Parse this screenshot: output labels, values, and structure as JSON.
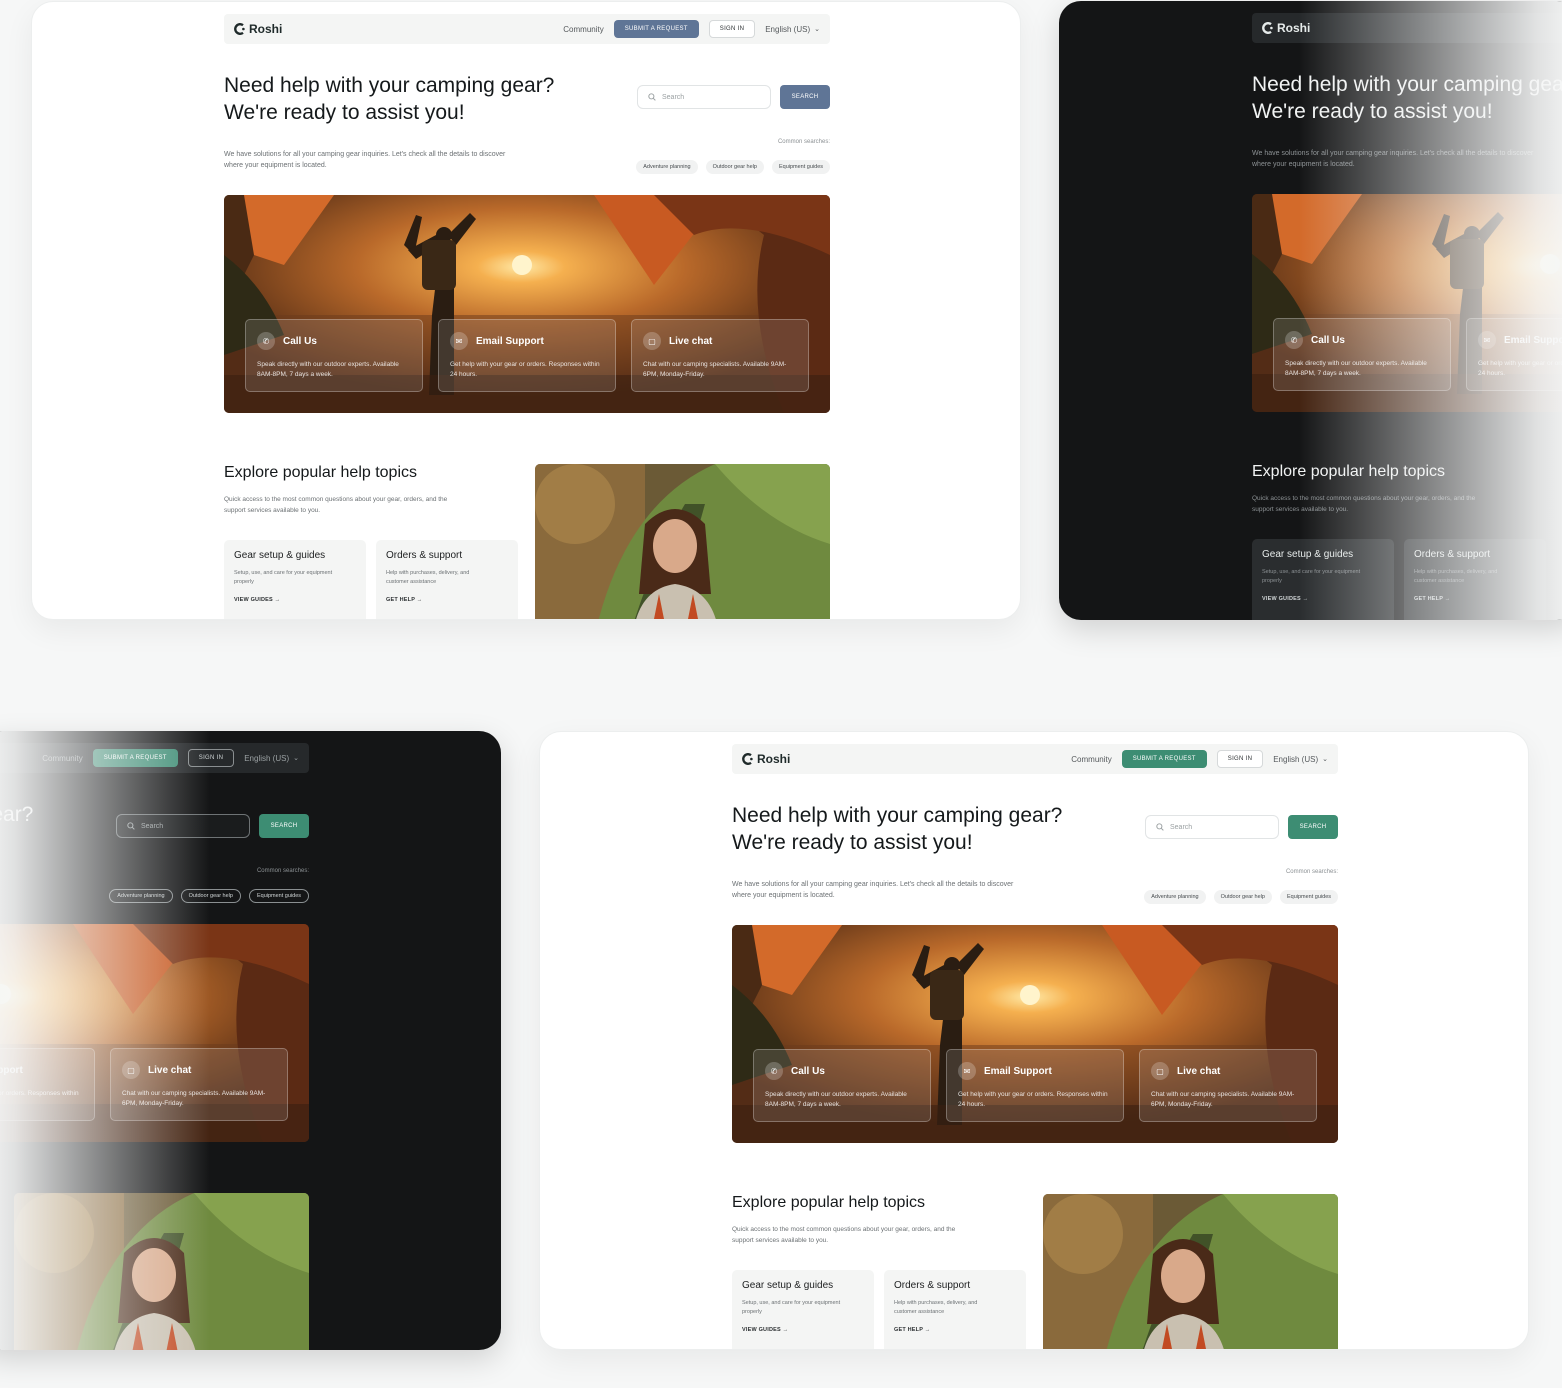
{
  "site": {
    "brand": "Roshi",
    "nav": {
      "community": "Community",
      "submit_request": "SUBMIT A REQUEST",
      "sign_in": "SIGN IN",
      "language": "English (US)"
    },
    "hero": {
      "title": "Need help with your camping gear? We're ready to assist you!",
      "subtitle": "We have solutions for all your camping gear inquiries. Let's check all the details to discover where your equipment is located.",
      "search_placeholder": "Search",
      "search_button": "SEARCH",
      "common_searches_label": "Common searches:",
      "chips": [
        "Adventure planning",
        "Outdoor gear help",
        "Equipment guides"
      ]
    },
    "contact_cards": [
      {
        "title": "Call Us",
        "desc": "Speak directly with our outdoor experts. Available 8AM-8PM, 7 days a week."
      },
      {
        "title": "Email Support",
        "desc": "Get help with your gear or orders. Responses within 24 hours."
      },
      {
        "title": "Live chat",
        "desc": "Chat with our camping specialists. Available 9AM-6PM, Monday-Friday."
      }
    ],
    "explore": {
      "title": "Explore popular help topics",
      "subtitle": "Quick access to the most common questions about your gear, orders, and the support services available to you.",
      "topics": [
        {
          "title": "Gear setup & guides",
          "desc": "Setup, use, and care for your equipment properly",
          "link": "VIEW GUIDES →"
        },
        {
          "title": "Orders & support",
          "desc": "Help with purchases, delivery, and customer assistance",
          "link": "GET HELP →"
        }
      ]
    }
  },
  "colors": {
    "blue_accent": "#5f7596",
    "green_accent": "#3d8d73",
    "dark_bg": "#141516",
    "page_bg": "#f6f7f7"
  }
}
